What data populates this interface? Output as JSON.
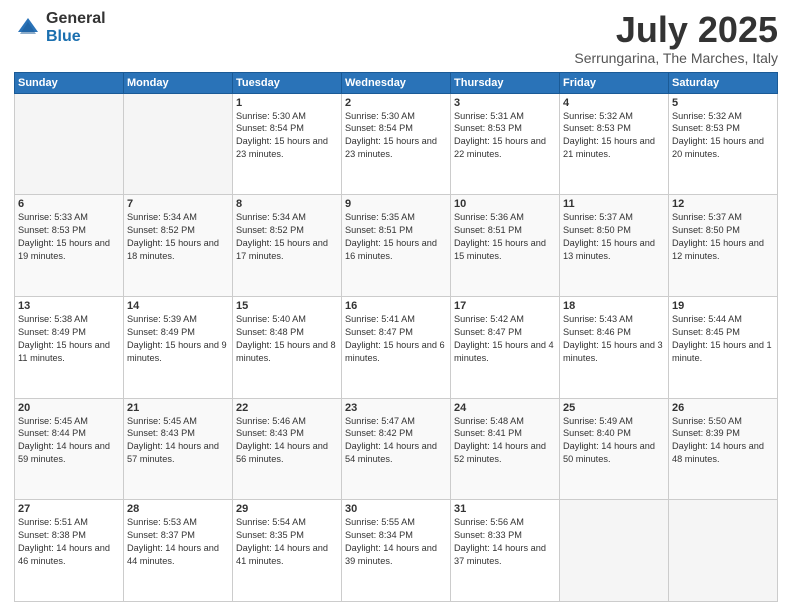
{
  "logo": {
    "general": "General",
    "blue": "Blue"
  },
  "header": {
    "title": "July 2025",
    "subtitle": "Serrungarina, The Marches, Italy"
  },
  "days_of_week": [
    "Sunday",
    "Monday",
    "Tuesday",
    "Wednesday",
    "Thursday",
    "Friday",
    "Saturday"
  ],
  "weeks": [
    [
      {
        "day": "",
        "sunrise": "",
        "sunset": "",
        "daylight": "",
        "empty": true
      },
      {
        "day": "",
        "sunrise": "",
        "sunset": "",
        "daylight": "",
        "empty": true
      },
      {
        "day": "1",
        "sunrise": "Sunrise: 5:30 AM",
        "sunset": "Sunset: 8:54 PM",
        "daylight": "Daylight: 15 hours and 23 minutes.",
        "empty": false
      },
      {
        "day": "2",
        "sunrise": "Sunrise: 5:30 AM",
        "sunset": "Sunset: 8:54 PM",
        "daylight": "Daylight: 15 hours and 23 minutes.",
        "empty": false
      },
      {
        "day": "3",
        "sunrise": "Sunrise: 5:31 AM",
        "sunset": "Sunset: 8:53 PM",
        "daylight": "Daylight: 15 hours and 22 minutes.",
        "empty": false
      },
      {
        "day": "4",
        "sunrise": "Sunrise: 5:32 AM",
        "sunset": "Sunset: 8:53 PM",
        "daylight": "Daylight: 15 hours and 21 minutes.",
        "empty": false
      },
      {
        "day": "5",
        "sunrise": "Sunrise: 5:32 AM",
        "sunset": "Sunset: 8:53 PM",
        "daylight": "Daylight: 15 hours and 20 minutes.",
        "empty": false
      }
    ],
    [
      {
        "day": "6",
        "sunrise": "Sunrise: 5:33 AM",
        "sunset": "Sunset: 8:53 PM",
        "daylight": "Daylight: 15 hours and 19 minutes.",
        "empty": false
      },
      {
        "day": "7",
        "sunrise": "Sunrise: 5:34 AM",
        "sunset": "Sunset: 8:52 PM",
        "daylight": "Daylight: 15 hours and 18 minutes.",
        "empty": false
      },
      {
        "day": "8",
        "sunrise": "Sunrise: 5:34 AM",
        "sunset": "Sunset: 8:52 PM",
        "daylight": "Daylight: 15 hours and 17 minutes.",
        "empty": false
      },
      {
        "day": "9",
        "sunrise": "Sunrise: 5:35 AM",
        "sunset": "Sunset: 8:51 PM",
        "daylight": "Daylight: 15 hours and 16 minutes.",
        "empty": false
      },
      {
        "day": "10",
        "sunrise": "Sunrise: 5:36 AM",
        "sunset": "Sunset: 8:51 PM",
        "daylight": "Daylight: 15 hours and 15 minutes.",
        "empty": false
      },
      {
        "day": "11",
        "sunrise": "Sunrise: 5:37 AM",
        "sunset": "Sunset: 8:50 PM",
        "daylight": "Daylight: 15 hours and 13 minutes.",
        "empty": false
      },
      {
        "day": "12",
        "sunrise": "Sunrise: 5:37 AM",
        "sunset": "Sunset: 8:50 PM",
        "daylight": "Daylight: 15 hours and 12 minutes.",
        "empty": false
      }
    ],
    [
      {
        "day": "13",
        "sunrise": "Sunrise: 5:38 AM",
        "sunset": "Sunset: 8:49 PM",
        "daylight": "Daylight: 15 hours and 11 minutes.",
        "empty": false
      },
      {
        "day": "14",
        "sunrise": "Sunrise: 5:39 AM",
        "sunset": "Sunset: 8:49 PM",
        "daylight": "Daylight: 15 hours and 9 minutes.",
        "empty": false
      },
      {
        "day": "15",
        "sunrise": "Sunrise: 5:40 AM",
        "sunset": "Sunset: 8:48 PM",
        "daylight": "Daylight: 15 hours and 8 minutes.",
        "empty": false
      },
      {
        "day": "16",
        "sunrise": "Sunrise: 5:41 AM",
        "sunset": "Sunset: 8:47 PM",
        "daylight": "Daylight: 15 hours and 6 minutes.",
        "empty": false
      },
      {
        "day": "17",
        "sunrise": "Sunrise: 5:42 AM",
        "sunset": "Sunset: 8:47 PM",
        "daylight": "Daylight: 15 hours and 4 minutes.",
        "empty": false
      },
      {
        "day": "18",
        "sunrise": "Sunrise: 5:43 AM",
        "sunset": "Sunset: 8:46 PM",
        "daylight": "Daylight: 15 hours and 3 minutes.",
        "empty": false
      },
      {
        "day": "19",
        "sunrise": "Sunrise: 5:44 AM",
        "sunset": "Sunset: 8:45 PM",
        "daylight": "Daylight: 15 hours and 1 minute.",
        "empty": false
      }
    ],
    [
      {
        "day": "20",
        "sunrise": "Sunrise: 5:45 AM",
        "sunset": "Sunset: 8:44 PM",
        "daylight": "Daylight: 14 hours and 59 minutes.",
        "empty": false
      },
      {
        "day": "21",
        "sunrise": "Sunrise: 5:45 AM",
        "sunset": "Sunset: 8:43 PM",
        "daylight": "Daylight: 14 hours and 57 minutes.",
        "empty": false
      },
      {
        "day": "22",
        "sunrise": "Sunrise: 5:46 AM",
        "sunset": "Sunset: 8:43 PM",
        "daylight": "Daylight: 14 hours and 56 minutes.",
        "empty": false
      },
      {
        "day": "23",
        "sunrise": "Sunrise: 5:47 AM",
        "sunset": "Sunset: 8:42 PM",
        "daylight": "Daylight: 14 hours and 54 minutes.",
        "empty": false
      },
      {
        "day": "24",
        "sunrise": "Sunrise: 5:48 AM",
        "sunset": "Sunset: 8:41 PM",
        "daylight": "Daylight: 14 hours and 52 minutes.",
        "empty": false
      },
      {
        "day": "25",
        "sunrise": "Sunrise: 5:49 AM",
        "sunset": "Sunset: 8:40 PM",
        "daylight": "Daylight: 14 hours and 50 minutes.",
        "empty": false
      },
      {
        "day": "26",
        "sunrise": "Sunrise: 5:50 AM",
        "sunset": "Sunset: 8:39 PM",
        "daylight": "Daylight: 14 hours and 48 minutes.",
        "empty": false
      }
    ],
    [
      {
        "day": "27",
        "sunrise": "Sunrise: 5:51 AM",
        "sunset": "Sunset: 8:38 PM",
        "daylight": "Daylight: 14 hours and 46 minutes.",
        "empty": false
      },
      {
        "day": "28",
        "sunrise": "Sunrise: 5:53 AM",
        "sunset": "Sunset: 8:37 PM",
        "daylight": "Daylight: 14 hours and 44 minutes.",
        "empty": false
      },
      {
        "day": "29",
        "sunrise": "Sunrise: 5:54 AM",
        "sunset": "Sunset: 8:35 PM",
        "daylight": "Daylight: 14 hours and 41 minutes.",
        "empty": false
      },
      {
        "day": "30",
        "sunrise": "Sunrise: 5:55 AM",
        "sunset": "Sunset: 8:34 PM",
        "daylight": "Daylight: 14 hours and 39 minutes.",
        "empty": false
      },
      {
        "day": "31",
        "sunrise": "Sunrise: 5:56 AM",
        "sunset": "Sunset: 8:33 PM",
        "daylight": "Daylight: 14 hours and 37 minutes.",
        "empty": false
      },
      {
        "day": "",
        "sunrise": "",
        "sunset": "",
        "daylight": "",
        "empty": true
      },
      {
        "day": "",
        "sunrise": "",
        "sunset": "",
        "daylight": "",
        "empty": true
      }
    ]
  ]
}
